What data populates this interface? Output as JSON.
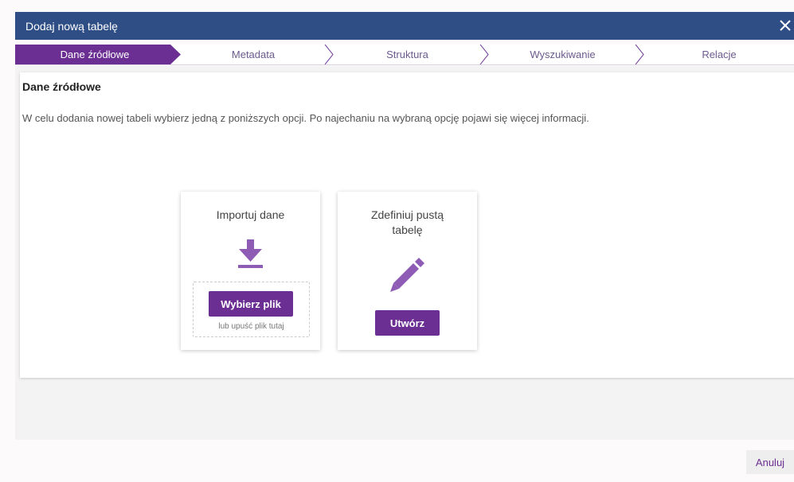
{
  "dialog": {
    "title": "Dodaj nową tabelę",
    "close_icon": "close-icon"
  },
  "steps": [
    {
      "label": "Dane źródłowe",
      "active": true
    },
    {
      "label": "Metadata",
      "active": false
    },
    {
      "label": "Struktura",
      "active": false
    },
    {
      "label": "Wyszukiwanie",
      "active": false
    },
    {
      "label": "Relacje",
      "active": false
    }
  ],
  "section": {
    "title": "Dane źródłowe",
    "description": "W celu dodania nowej tabeli wybierz jedną z poniższych opcji. Po najechaniu na wybraną opcję pojawi się więcej informacji."
  },
  "cards": {
    "import": {
      "title": "Importuj dane",
      "icon": "download-icon",
      "button": "Wybierz plik",
      "drop_hint": "lub upuść plik tutaj"
    },
    "define": {
      "title": "Zdefiniuj pustą tabelę",
      "icon": "pencil-icon",
      "button": "Utwórz"
    }
  },
  "footer": {
    "cancel": "Anuluj"
  },
  "colors": {
    "header": "#2f4e86",
    "accent": "#6b2f93",
    "icon": "#8e5bb5"
  }
}
